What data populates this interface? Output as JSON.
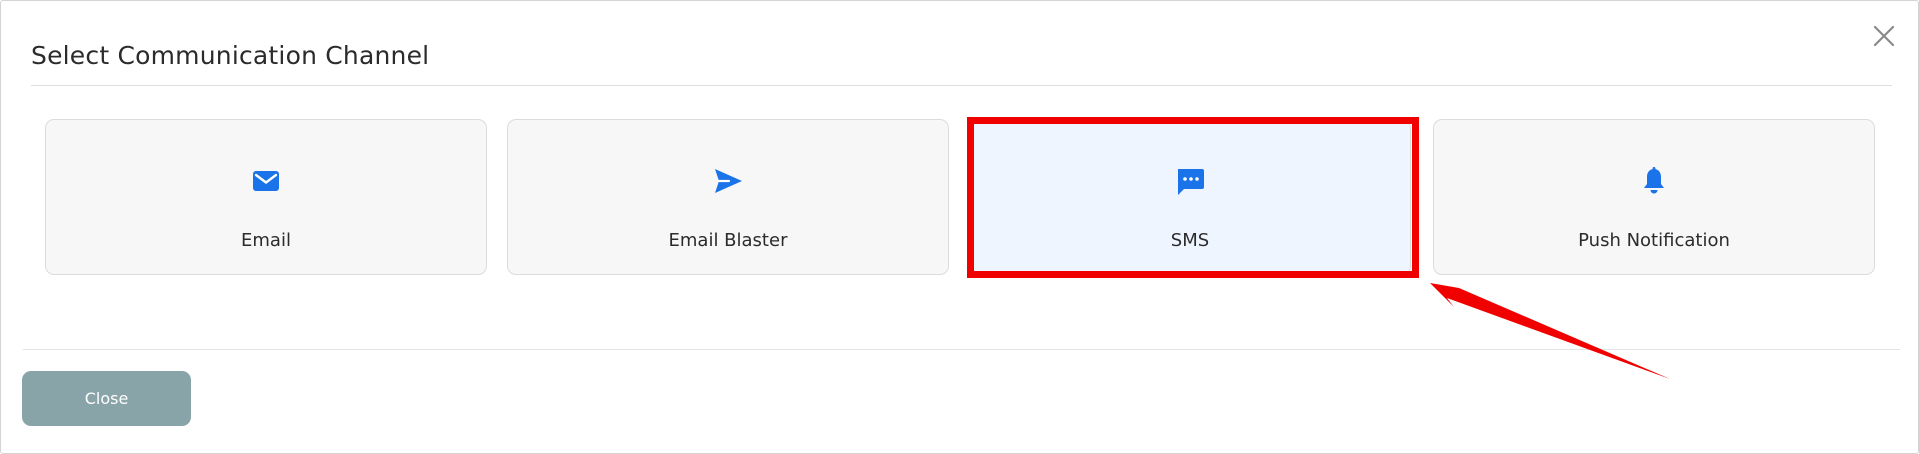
{
  "modal": {
    "title": "Select Communication Channel",
    "close_icon": "close-icon"
  },
  "channels": [
    {
      "label": "Email",
      "icon": "envelope-icon",
      "selected": false
    },
    {
      "label": "Email Blaster",
      "icon": "send-icon",
      "selected": false
    },
    {
      "label": "SMS",
      "icon": "chat-bubble-icon",
      "selected": true
    },
    {
      "label": "Push Notification",
      "icon": "bell-icon",
      "selected": false
    }
  ],
  "annotation": {
    "highlight_color": "#f10000",
    "target": "SMS"
  },
  "footer": {
    "close_label": "Close"
  },
  "colors": {
    "icon_blue": "#1a73e8",
    "selected_card_bg": "#eef5ff",
    "card_bg": "#f7f7f7",
    "close_button_bg": "#89a4a8"
  }
}
